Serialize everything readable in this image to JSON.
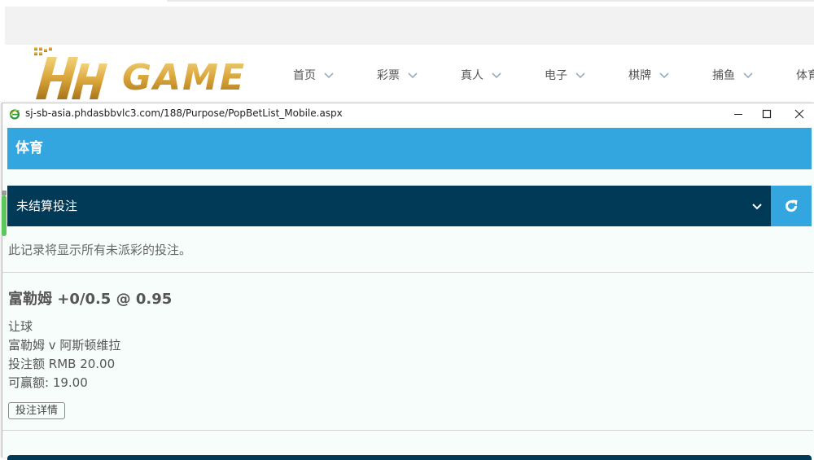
{
  "site": {
    "logo_text": "HH GAME",
    "nav": [
      {
        "label": "首页"
      },
      {
        "label": "彩票"
      },
      {
        "label": "真人"
      },
      {
        "label": "电子"
      },
      {
        "label": "棋牌"
      },
      {
        "label": "捕鱼"
      },
      {
        "label": "体育"
      }
    ]
  },
  "popup": {
    "url": "sj-sb-asia.phdasbbvlc3.com/188/Purpose/PopBetList_Mobile.aspx",
    "sport_title": "体育",
    "filter_selected": "未结算投注",
    "info": "此记录将显示所有未派彩的投注。",
    "bet": {
      "title": "富勒姆 +0/0.5 @ 0.95",
      "type": "让球",
      "match": "富勒姆 v 阿斯顿维拉",
      "stake": "投注额 RMB 20.00",
      "potential_win": "可赢额: 19.00",
      "detail_button": "投注详情"
    }
  },
  "colors": {
    "header_blue": "#33a6df",
    "navy": "#003a57",
    "logo_gold": "#d9a53a"
  }
}
